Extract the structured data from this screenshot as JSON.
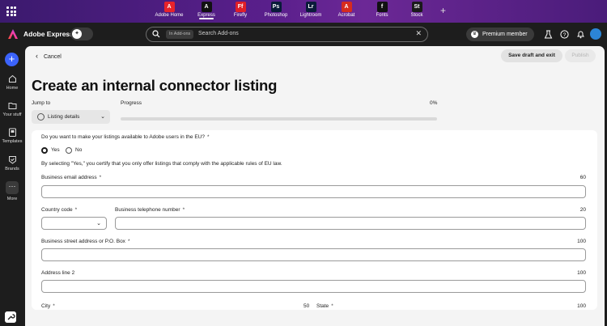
{
  "appbar": {
    "apps": [
      {
        "label": "Adobe Home",
        "glyph": "A",
        "color": "#e8232a",
        "active": false
      },
      {
        "label": "Express",
        "glyph": "A",
        "color": "#111111",
        "active": true
      },
      {
        "label": "Firefly",
        "glyph": "Ff",
        "color": "#e01e28",
        "active": false
      },
      {
        "label": "Photoshop",
        "glyph": "Ps",
        "color": "#0a1b3a",
        "active": false
      },
      {
        "label": "Lightroom",
        "glyph": "Lr",
        "color": "#0a1b3a",
        "active": false
      },
      {
        "label": "Acrobat",
        "glyph": "A",
        "color": "#d62b1f",
        "active": false
      },
      {
        "label": "Fonts",
        "glyph": "f",
        "color": "#111111",
        "active": false
      },
      {
        "label": "Stock",
        "glyph": "St",
        "color": "#1a1a1a",
        "active": false
      }
    ],
    "add_icon": "+"
  },
  "header": {
    "brand": "Adobe Express",
    "search_chip": "In Add-ons",
    "search_placeholder": "Search Add-ons",
    "search_clear": "✕",
    "premium_label": "Premium member"
  },
  "rail": {
    "add_label": "+",
    "items": [
      {
        "label": "Home"
      },
      {
        "label": "Your stuff"
      },
      {
        "label": "Templates"
      },
      {
        "label": "Brands"
      },
      {
        "label": "More"
      }
    ]
  },
  "toolbar": {
    "cancel_label": "Cancel",
    "save_label": "Save draft and exit",
    "publish_label": "Publish"
  },
  "page": {
    "title": "Create an internal connector listing",
    "jump_to_label": "Jump to",
    "jump_selected": "Listing details",
    "progress_label": "Progress",
    "progress_value": "0%",
    "progress_fraction": 0
  },
  "form": {
    "eu_question": "Do you want to make your listings available to Adobe users in the EU?",
    "required_mark": "*",
    "radio_yes": "Yes",
    "radio_no": "No",
    "selected": "Yes",
    "eu_note": "By selecting \"Yes,\" you certify that you only offer listings that comply with the applicable rules of EU law.",
    "email_label": "Business email address",
    "email_count": "60",
    "country_label": "Country code",
    "phone_label": "Business telephone number",
    "phone_count": "20",
    "street_label": "Business street address or P.O. Box",
    "street_count": "100",
    "address2_label": "Address line 2",
    "address2_count": "100",
    "city_label": "City",
    "city_count": "50",
    "state_label": "State",
    "state_count": "100"
  }
}
